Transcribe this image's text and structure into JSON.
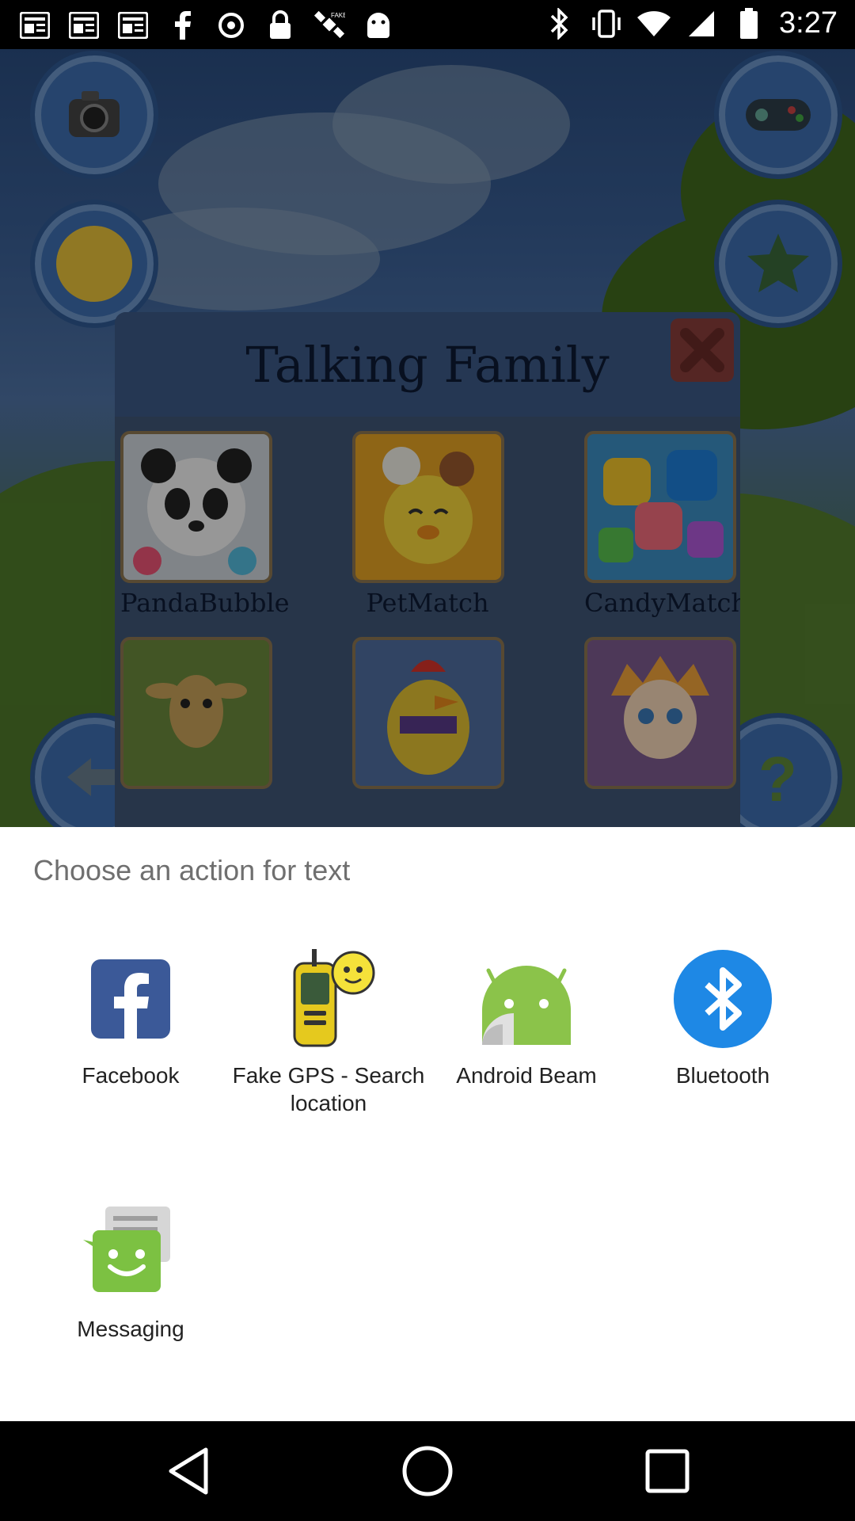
{
  "status_bar": {
    "time": "3:27",
    "left_icons": [
      "newspaper-icon",
      "newspaper-icon",
      "newspaper-icon",
      "facebook-icon",
      "sync-icon",
      "lock-icon",
      "satellite-icon",
      "android-icon"
    ],
    "right_icons": [
      "bluetooth-icon",
      "vibrate-icon",
      "wifi-icon",
      "signal-icon",
      "battery-icon"
    ]
  },
  "popup": {
    "title": "Talking Family",
    "games": [
      {
        "label": "PandaBubble",
        "thumb_color": "#ffffff"
      },
      {
        "label": "PetMatch",
        "thumb_color": "#f2c12e"
      },
      {
        "label": "CandyMatch",
        "thumb_color": "#4aa6d6"
      },
      {
        "label": "",
        "thumb_color": "#6b8a3c"
      },
      {
        "label": "",
        "thumb_color": "#4f6fa0"
      },
      {
        "label": "",
        "thumb_color": "#7d5b8e"
      }
    ]
  },
  "sheet": {
    "title": "Choose an action for text",
    "apps": [
      {
        "label": "Facebook",
        "icon": "facebook-icon",
        "color": "#3b5998"
      },
      {
        "label": "Fake GPS - Search location",
        "icon": "gps-device-icon",
        "color": "#f5d31e"
      },
      {
        "label": "Android Beam",
        "icon": "android-beam-icon",
        "color": "#8bc34a"
      },
      {
        "label": "Bluetooth",
        "icon": "bluetooth-icon",
        "color": "#1e88e5"
      },
      {
        "label": "Messaging",
        "icon": "messaging-icon",
        "color": "#7cc142"
      }
    ]
  },
  "nav_bar": {
    "buttons": [
      "back-icon",
      "home-icon",
      "recents-icon"
    ]
  }
}
